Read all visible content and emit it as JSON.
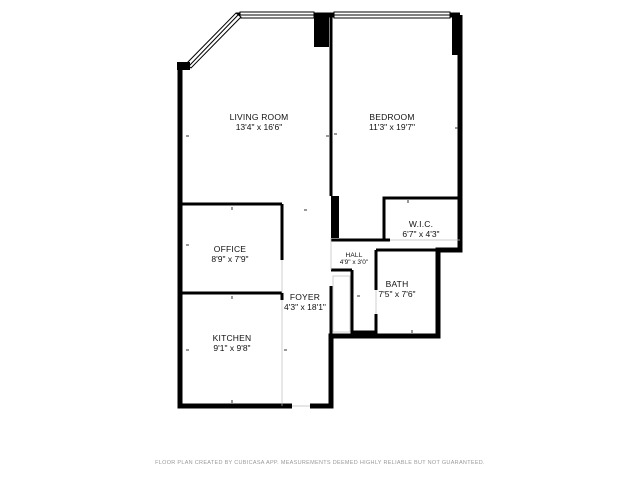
{
  "plan": {
    "rooms": [
      {
        "id": "living-room",
        "name": "LIVING ROOM",
        "dims": "13'4\" x 16'6\""
      },
      {
        "id": "bedroom",
        "name": "BEDROOM",
        "dims": "11'3\" x 19'7\""
      },
      {
        "id": "wic",
        "name": "W.I.C.",
        "dims": "6'7\" x 4'3\""
      },
      {
        "id": "office",
        "name": "OFFICE",
        "dims": "8'9\" x 7'9\""
      },
      {
        "id": "hall",
        "name": "HALL",
        "dims": "4'9\" x 3'0\""
      },
      {
        "id": "bath",
        "name": "BATH",
        "dims": "7'5\" x 7'6\""
      },
      {
        "id": "foyer",
        "name": "FOYER",
        "dims": "4'3\" x 18'1\""
      },
      {
        "id": "kitchen",
        "name": "KITCHEN",
        "dims": "9'1\" x 9'8\""
      }
    ],
    "footer": "FLOOR PLAN CREATED BY CUBICASA APP. MEASUREMENTS DEEMED HIGHLY RELIABLE BUT NOT GUARANTEED.",
    "wall_color": "#000000",
    "window_color": "#ffffff"
  }
}
